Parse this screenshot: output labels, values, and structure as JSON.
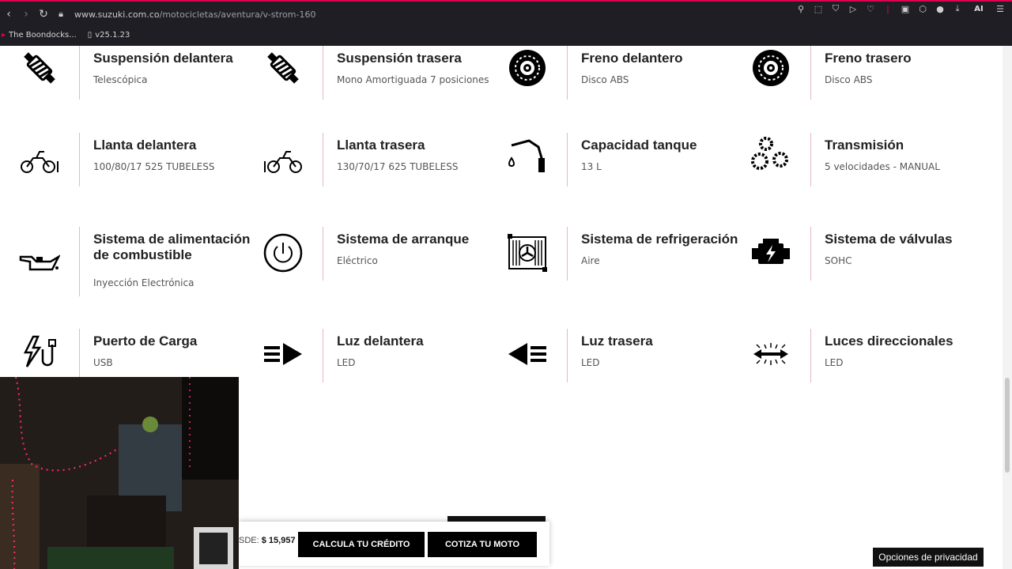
{
  "browser": {
    "url_host": "www.suzuki.com.co",
    "url_path": "/motocicletas/aventura/v-strom-160",
    "bookmarks": [
      "The Boondocks...",
      "v25.1.23"
    ],
    "ai_label": "AI"
  },
  "specs": [
    {
      "icon": "front-suspension-icon",
      "title": "Suspensión delantera",
      "value": "Telescópica"
    },
    {
      "icon": "rear-suspension-icon",
      "title": "Suspensión trasera",
      "value": "Mono Amortiguada 7 posiciones"
    },
    {
      "icon": "front-brake-disc-icon",
      "title": "Freno delantero",
      "value": "Disco ABS"
    },
    {
      "icon": "rear-brake-disc-icon",
      "title": "Freno trasero",
      "value": "Disco ABS"
    },
    {
      "icon": "front-tire-motorcycle-icon",
      "title": "Llanta delantera",
      "value": "100/80/17 525 TUBELESS"
    },
    {
      "icon": "rear-tire-motorcycle-icon",
      "title": "Llanta trasera",
      "value": "130/70/17 625 TUBELESS"
    },
    {
      "icon": "fuel-nozzle-icon",
      "title": "Capacidad tanque",
      "value": "13 L"
    },
    {
      "icon": "gears-icon",
      "title": "Transmisión",
      "value": "5 velocidades - MANUAL"
    },
    {
      "icon": "oil-can-icon",
      "title": "Sistema de alimentación de combustible",
      "value": "Inyección Electrónica"
    },
    {
      "icon": "power-button-icon",
      "title": "Sistema de arranque",
      "value": "Eléctrico"
    },
    {
      "icon": "radiator-fan-icon",
      "title": "Sistema de refrigeración",
      "value": "Aire"
    },
    {
      "icon": "engine-icon",
      "title": "Sistema de válvulas",
      "value": "SOHC"
    },
    {
      "icon": "charging-port-icon",
      "title": "Puerto de Carga",
      "value": "USB"
    },
    {
      "icon": "headlight-icon",
      "title": "Luz delantera",
      "value": "LED"
    },
    {
      "icon": "taillight-icon",
      "title": "Luz trasera",
      "value": "LED"
    },
    {
      "icon": "turn-signals-icon",
      "title": "Luces direccionales",
      "value": "LED"
    }
  ],
  "cta": {
    "price_prefix": "SDE:",
    "price_value": "$ 15,957",
    "credit_button": "CALCULA TU CRÉDITO",
    "quote_button": "COTIZA TU MOTO"
  },
  "privacy_button": "Opciones de privacidad"
}
